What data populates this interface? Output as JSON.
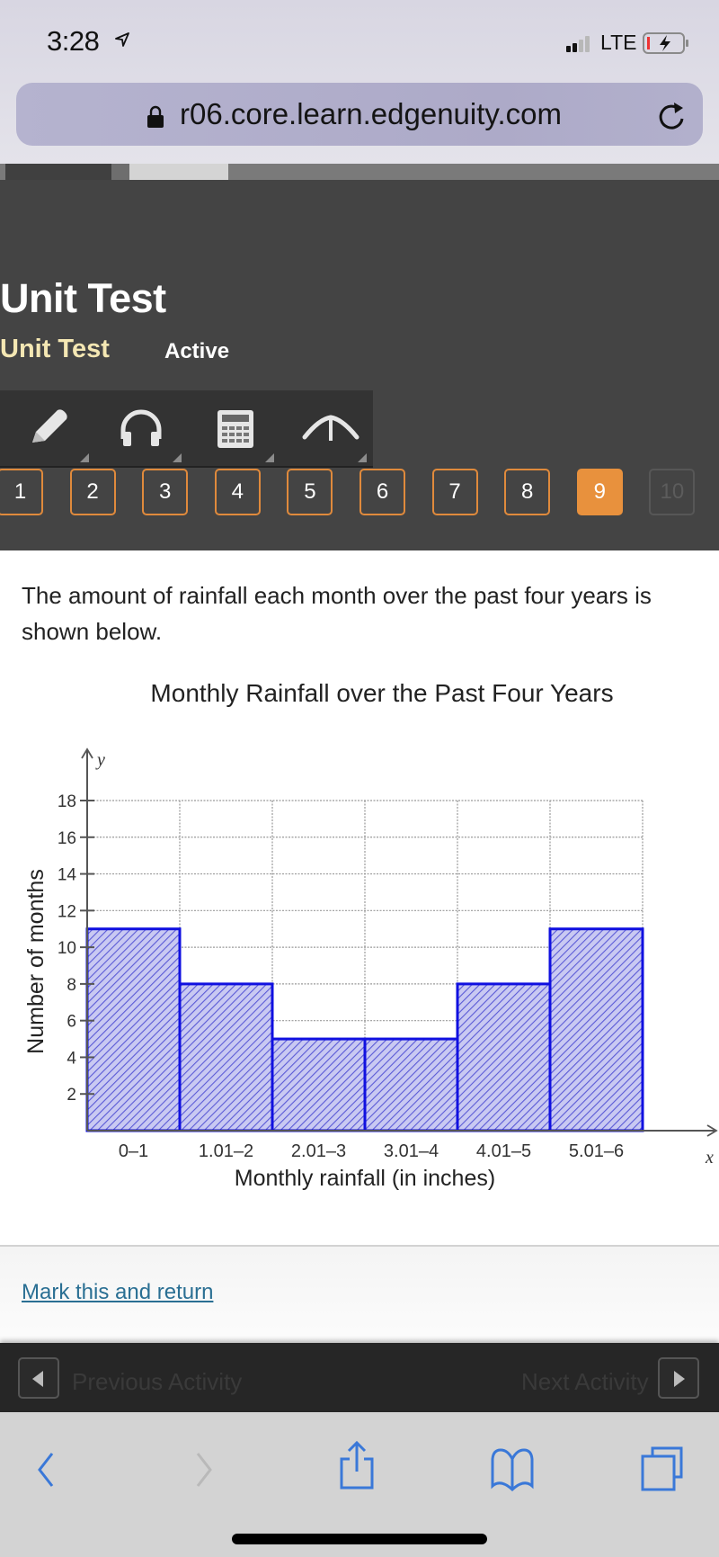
{
  "status_bar": {
    "time": "3:28",
    "network": "LTE",
    "icons": [
      "location-arrow-icon",
      "signal-icon",
      "battery-charging-icon"
    ]
  },
  "browser": {
    "url": "r06.core.learn.edgenuity.com",
    "icons": [
      "lock-icon",
      "reload-icon",
      "back-icon",
      "forward-icon",
      "share-icon",
      "bookmarks-icon",
      "tabs-icon"
    ]
  },
  "header": {
    "title": "Unit Test",
    "subtitle": "Unit Test",
    "status": "Active",
    "subtitle_color": "#f4e7b3"
  },
  "toolbar": {
    "tools": [
      {
        "name": "pencil-icon"
      },
      {
        "name": "headphones-icon"
      },
      {
        "name": "calculator-icon"
      },
      {
        "name": "reference-icon"
      }
    ]
  },
  "question_nav": {
    "accent_color": "#e8913d",
    "current": 9,
    "items": [
      {
        "label": "1",
        "state": "normal"
      },
      {
        "label": "2",
        "state": "normal"
      },
      {
        "label": "3",
        "state": "normal"
      },
      {
        "label": "4",
        "state": "normal"
      },
      {
        "label": "5",
        "state": "normal"
      },
      {
        "label": "6",
        "state": "normal"
      },
      {
        "label": "7",
        "state": "normal"
      },
      {
        "label": "8",
        "state": "normal"
      },
      {
        "label": "9",
        "state": "current"
      },
      {
        "label": "10",
        "state": "disabled"
      }
    ]
  },
  "question": {
    "text": "The amount of rainfall each month over the past four years is shown below."
  },
  "chart_data": {
    "type": "bar",
    "title": "Monthly Rainfall over the Past Four Years",
    "xlabel": "Monthly rainfall (in inches)",
    "ylabel": "Number of months",
    "x_axis_symbol": "x",
    "y_axis_symbol": "y",
    "categories": [
      "0–1",
      "1.01–2",
      "2.01–3",
      "3.01–4",
      "4.01–5",
      "5.01–6"
    ],
    "values": [
      11,
      8,
      5,
      5,
      8,
      11
    ],
    "ylim": [
      0,
      18
    ],
    "yticks": [
      2,
      4,
      6,
      8,
      10,
      12,
      14,
      16,
      18
    ],
    "grid": true,
    "bar_style": "histogram, hatched",
    "bar_color": "#1010e0",
    "legend": "none"
  },
  "footer": {
    "mark_link": "Mark this and return",
    "prev_label": "Previous Activity",
    "next_label": "Next Activity"
  }
}
